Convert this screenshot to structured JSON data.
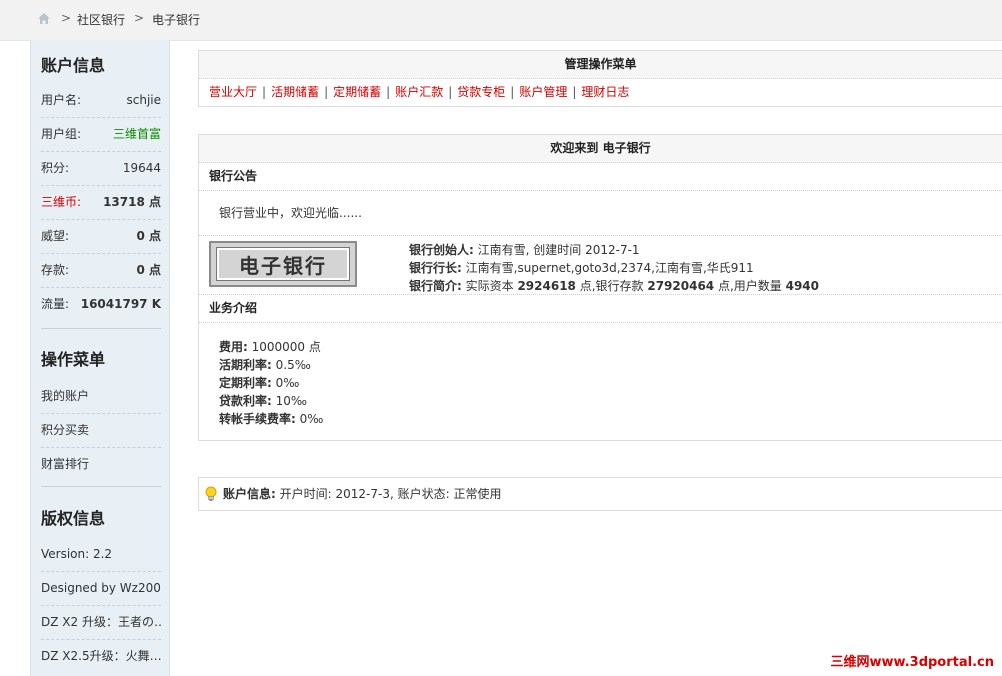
{
  "breadcrumb": {
    "sep": ">",
    "items": [
      "社区银行",
      "电子银行"
    ]
  },
  "sidebar": {
    "account_title": "账户信息",
    "account_rows": [
      {
        "label": "用户名:",
        "value": "schjie"
      },
      {
        "label": "用户组:",
        "value": "三维首富"
      },
      {
        "label": "积分:",
        "value": "19644"
      },
      {
        "label": "三维币:",
        "value": "13718 点"
      },
      {
        "label": "威望:",
        "value": "0 点"
      },
      {
        "label": "存款:",
        "value": "0 点"
      },
      {
        "label": "流量:",
        "value": "16041797 K"
      }
    ],
    "ops_title": "操作菜单",
    "ops_items": [
      "我的账户",
      "积分买卖",
      "财富排行"
    ],
    "copyright_title": "版权信息",
    "copyright_items": [
      "Version: 2.2",
      "Designed by Wz200…",
      "DZ X2 升级：王者の…",
      "DZ X2.5升级：火舞…"
    ]
  },
  "menu_panel": {
    "title": "管理操作菜单",
    "sep": "|",
    "items": [
      "营业大厅",
      "活期储蓄",
      "定期储蓄",
      "账户汇款",
      "贷款专柜",
      "账户管理",
      "理财日志"
    ]
  },
  "welcome_panel": {
    "title": "欢迎来到 电子银行",
    "notice_title": "银行公告",
    "notice_text": "银行营业中，欢迎光临......",
    "logo_text": "电子银行",
    "founder_label": "银行创始人:",
    "founder_value": " 江南有雪, 创建时间 2012-7-1",
    "director_label": "银行行长:",
    "director_value": " 江南有雪,supernet,goto3d,2374,江南有雪,华氏911",
    "intro_label": "银行简介:",
    "intro_pre": " 实际资本 ",
    "capital": "2924618",
    "intro_mid": " 点,银行存款 ",
    "deposits": "27920464",
    "intro_mid2": " 点,用户数量 ",
    "users": "4940",
    "business_title": "业务介绍",
    "fees": [
      {
        "label": "费用:",
        "value": " 1000000 点"
      },
      {
        "label": "活期利率:",
        "value": " 0.5‰"
      },
      {
        "label": "定期利率:",
        "value": " 0‰"
      },
      {
        "label": "贷款利率:",
        "value": " 10‰"
      },
      {
        "label": "转帐手续费率:",
        "value": " 0‰"
      }
    ]
  },
  "account_panel": {
    "label": "账户信息:",
    "value": " 开户时间: 2012-7-3, 账户状态: 正常使用"
  },
  "watermark": "三维网www.3dportal.cn",
  "colors": {
    "link_red": "#d40000",
    "group_green": "#0a8a00",
    "sidebar_bg": "#e8eff5"
  }
}
